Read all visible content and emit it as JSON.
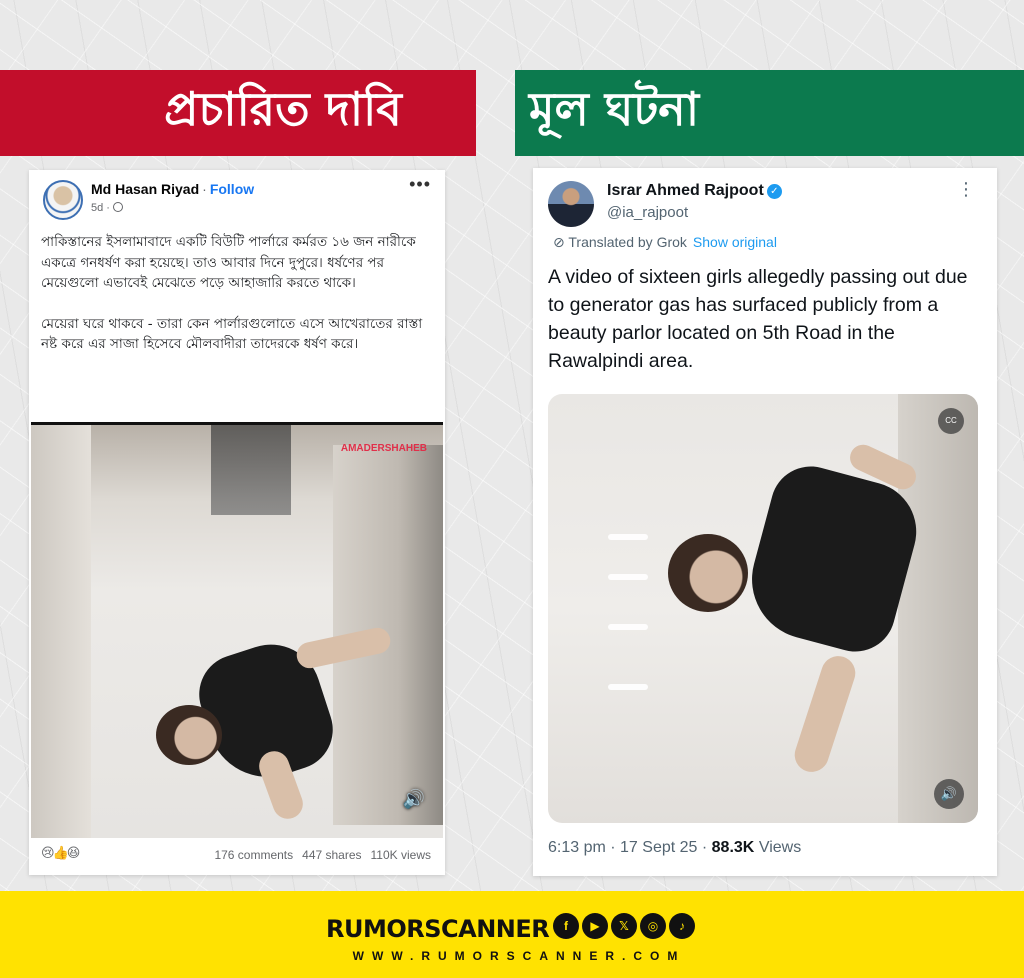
{
  "banners": {
    "claim": "প্রচারিত দাবি",
    "fact": "মূল ঘটনা"
  },
  "facebook_post": {
    "author": "Md Hasan Riyad",
    "separator": "·",
    "follow_label": "Follow",
    "time": "5d ·",
    "more": "•••",
    "paragraph1": "পাকিস্তানের ইসলামাবাদে একটি বিউটি পার্লারে কর্মরত ১৬ জন নারীকে একত্রে গনধর্ষণ করা হয়েছে। তাও আবার দিনে দুপুরে। ধর্ষণের পর মেয়েগুলো এভাবেই মেঝেতে পড়ে আহাজারি করতে থাকে।",
    "paragraph2": "মেয়েরা ঘরে থাকবে - তারা কেন পার্লারগুলোতে এসে আখেরাতের রাস্তা নষ্ট করে এর সাজা হিসেবে মৌলবাদীরা তাদেরকে ধর্ষণ করে।",
    "video_watermark": "AMADERSHAHEB",
    "reactions": "😢👍😆",
    "comments": "176 comments",
    "shares": "447 shares",
    "views": "110K views"
  },
  "tweet": {
    "name": "Israr Ahmed Rajpoot",
    "verified_mark": "✓",
    "handle": "@ia_rajpoot",
    "more": "⋮",
    "translated": "Translated by Grok",
    "show_original": "Show original",
    "text": "A video of sixteen girls allegedly passing out due to generator gas has surfaced publicly from a beauty parlor located on 5th Road in the Rawalpindi area.",
    "cc_label": "CC",
    "timestamp": "6:13 pm · 17 Sept 25 ·",
    "views_count": "88.3K",
    "views_label": "Views"
  },
  "footer": {
    "brand": "RUMORSCANNER",
    "website": "WWW.RUMORSCANNER.COM",
    "socials": [
      "f",
      "▶",
      "𝕏",
      "◎",
      "♪"
    ]
  },
  "colors": {
    "claim_red": "#c20e2b",
    "fact_green": "#0c7a4e",
    "footer_yellow": "#ffe201",
    "fb_blue": "#1877f2",
    "tw_blue": "#1d9bf0"
  }
}
